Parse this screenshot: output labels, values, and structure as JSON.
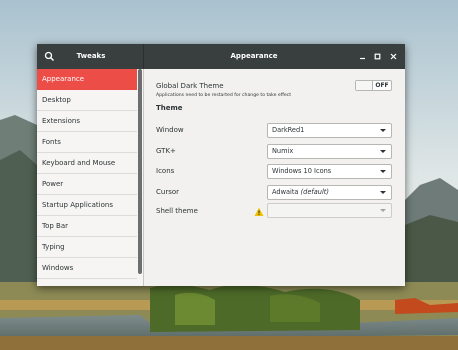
{
  "titlebar": {
    "app_title": "Tweaks",
    "page_title": "Appearance"
  },
  "sidebar": {
    "items": [
      {
        "label": "Appearance",
        "active": true
      },
      {
        "label": "Desktop"
      },
      {
        "label": "Extensions"
      },
      {
        "label": "Fonts"
      },
      {
        "label": "Keyboard and Mouse"
      },
      {
        "label": "Power"
      },
      {
        "label": "Startup Applications"
      },
      {
        "label": "Top Bar"
      },
      {
        "label": "Typing"
      },
      {
        "label": "Windows"
      }
    ]
  },
  "content": {
    "dark_theme": {
      "title": "Global Dark Theme",
      "note": "Applications need to be restarted for change to take effect",
      "toggle": "OFF"
    },
    "theme_heading": "Theme",
    "rows": [
      {
        "label": "Window",
        "value": "DarkRed1"
      },
      {
        "label": "GTK+",
        "value": "Numix"
      },
      {
        "label": "Icons",
        "value": "Windows 10 Icons"
      },
      {
        "label": "Cursor",
        "value": "Adwaita",
        "suffix": "(default)"
      },
      {
        "label": "Shell theme",
        "value": ""
      }
    ]
  },
  "colors": {
    "accent": "#ed4d47",
    "titlebar": "#393f3f",
    "warning": "#f0c000"
  }
}
